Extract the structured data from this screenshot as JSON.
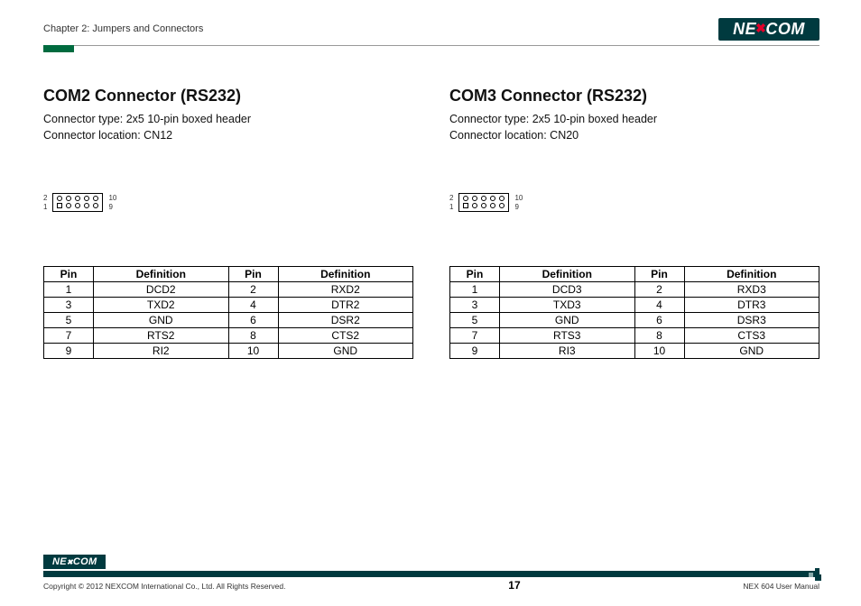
{
  "header": {
    "chapter": "Chapter 2: Jumpers and Connectors",
    "brand": "NEXCOM"
  },
  "sections": [
    {
      "title": "COM2 Connector (RS232)",
      "type_line": "Connector type: 2x5 10-pin boxed header",
      "location_line": "Connector location: CN12",
      "diagram": {
        "top_left": "2",
        "bottom_left": "1",
        "top_right": "10",
        "bottom_right": "9"
      },
      "table": {
        "headers": [
          "Pin",
          "Definition",
          "Pin",
          "Definition"
        ],
        "rows": [
          [
            "1",
            "DCD2",
            "2",
            "RXD2"
          ],
          [
            "3",
            "TXD2",
            "4",
            "DTR2"
          ],
          [
            "5",
            "GND",
            "6",
            "DSR2"
          ],
          [
            "7",
            "RTS2",
            "8",
            "CTS2"
          ],
          [
            "9",
            "RI2",
            "10",
            "GND"
          ]
        ]
      }
    },
    {
      "title": "COM3 Connector (RS232)",
      "type_line": "Connector type: 2x5 10-pin boxed header",
      "location_line": "Connector location: CN20",
      "diagram": {
        "top_left": "2",
        "bottom_left": "1",
        "top_right": "10",
        "bottom_right": "9"
      },
      "table": {
        "headers": [
          "Pin",
          "Definition",
          "Pin",
          "Definition"
        ],
        "rows": [
          [
            "1",
            "DCD3",
            "2",
            "RXD3"
          ],
          [
            "3",
            "TXD3",
            "4",
            "DTR3"
          ],
          [
            "5",
            "GND",
            "6",
            "DSR3"
          ],
          [
            "7",
            "RTS3",
            "8",
            "CTS3"
          ],
          [
            "9",
            "RI3",
            "10",
            "GND"
          ]
        ]
      }
    }
  ],
  "footer": {
    "copyright": "Copyright © 2012 NEXCOM International Co., Ltd. All Rights Reserved.",
    "page": "17",
    "doc": "NEX 604 User Manual"
  }
}
